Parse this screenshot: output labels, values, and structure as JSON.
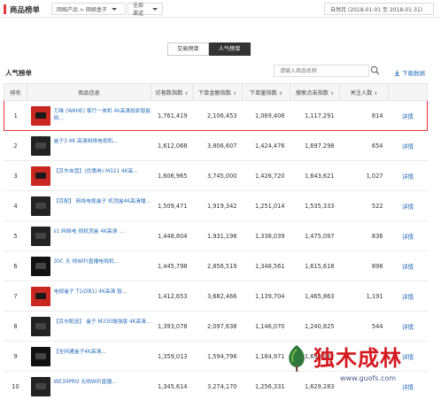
{
  "header": {
    "title": "商品榜单",
    "category_select": "网络产品 > 网络盒子",
    "channel_select": "全部渠道",
    "date_range": "自然月  (2018-01-01 至 2018-01-31)"
  },
  "tabs": [
    {
      "label": "交易榜单",
      "active": false
    },
    {
      "label": "人气榜单",
      "active": true
    }
  ],
  "section": {
    "title": "人气榜单",
    "search_placeholder": "请输入商品名称",
    "download_label": "下载数据"
  },
  "table": {
    "columns": [
      "排名",
      "商品信息",
      "访客数指数",
      "下单金额指数",
      "下单量指数",
      "搜索点击指数",
      "关注人数"
    ],
    "rows": [
      {
        "rank": "1",
        "name": "万维 (WAHE) 客厅一体机 4k高清投影智能网...",
        "visitors": "1,761,419",
        "amount": "2,106,453",
        "orders": "1,069,408",
        "search": "1,117,291",
        "followers": "814",
        "action": "详情",
        "thumb": "red"
      },
      {
        "rank": "2",
        "name": "盒子3 4K 高清网络电视机...",
        "visitors": "1,612,068",
        "amount": "3,806,607",
        "orders": "1,424,476",
        "search": "1,697,298",
        "followers": "654",
        "action": "详情",
        "thumb": "dark"
      },
      {
        "rank": "3",
        "name": "【京东自营】(优惠券) M321 4K高...",
        "visitors": "1,606,965",
        "amount": "3,745,000",
        "orders": "1,426,720",
        "search": "1,643,621",
        "followers": "1,027",
        "action": "详情",
        "thumb": "red"
      },
      {
        "rank": "4",
        "name": "【京配】 网络电视盒子 机顶盒4K高清播...",
        "visitors": "1,509,471",
        "amount": "1,919,342",
        "orders": "1,251,014",
        "search": "1,535,333",
        "followers": "522",
        "action": "详情",
        "thumb": "dark"
      },
      {
        "rank": "5",
        "name": "s1 网络电 视机顶盒 4K高清 ...",
        "visitors": "1,448,804",
        "amount": "1,931,198",
        "orders": "1,338,039",
        "search": "1,475,097",
        "followers": "836",
        "action": "详情",
        "thumb": "dark"
      },
      {
        "rank": "6",
        "name": "30C 无 线WIFI直播电视机...",
        "visitors": "1,445,798",
        "amount": "2,856,519",
        "orders": "1,348,561",
        "search": "1,615,618",
        "followers": "898",
        "action": "详情",
        "thumb": "black"
      },
      {
        "rank": "7",
        "name": "电视盒子 T1(DB1) 4K高清 智...",
        "visitors": "1,412,653",
        "amount": "3,682,466",
        "orders": "1,139,704",
        "search": "1,465,863",
        "followers": "1,191",
        "action": "详情",
        "thumb": "red"
      },
      {
        "rank": "8",
        "name": "【京东配送】 盒子 M330增强版 4K高清...",
        "visitors": "1,393,078",
        "amount": "2,097,638",
        "orders": "1,146,070",
        "search": "1,240,825",
        "followers": "544",
        "action": "详情",
        "thumb": "dark"
      },
      {
        "rank": "9",
        "name": "【全网通盒子4K高清...",
        "visitors": "1,359,013",
        "amount": "1,594,798",
        "orders": "1,184,971",
        "search": "1,690,112",
        "followers": "",
        "action": "详情",
        "thumb": "black"
      },
      {
        "rank": "10",
        "name": "WE30PRO 无线WiFi直播...",
        "visitors": "1,345,614",
        "amount": "3,274,170",
        "orders": "1,256,331",
        "search": "1,629,283",
        "followers": "",
        "action": "详情",
        "thumb": "dark"
      }
    ]
  },
  "watermark": {
    "text": "独木成林",
    "url": "www.guofs.com"
  },
  "colors": {
    "accent": "#e4393c",
    "link": "#2a6ebb",
    "tab_active_bg": "#333333"
  }
}
